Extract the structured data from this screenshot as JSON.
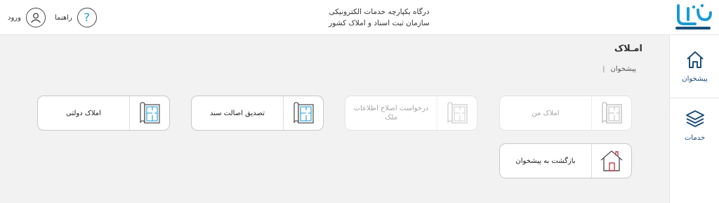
{
  "header": {
    "logo_text": "ثبت من",
    "title_line1": "درگاه یکپارچه خدمات الکترونیکی",
    "title_line2": "سازمان ثبت اسناد و املاک کشور",
    "help_label": "راهنما",
    "login_label": "ورود"
  },
  "sidebar": {
    "items": [
      {
        "label": "پیشخوان",
        "icon": "home-icon",
        "active": true
      },
      {
        "label": "خدمات",
        "icon": "layers-icon",
        "active": false
      }
    ]
  },
  "main": {
    "page_title": "امـلاک",
    "breadcrumb": {
      "current": "پیشخوان",
      "separator": "|"
    },
    "cards": [
      {
        "label": "املاک من",
        "icon": "floorplan-icon",
        "disabled": true
      },
      {
        "label": "درخواست اصلاح اطلاعات ملک",
        "icon": "floorplan-icon",
        "disabled": true
      },
      {
        "label": "تصدیق اصالت سند",
        "icon": "floorplan-icon",
        "disabled": false
      },
      {
        "label": "املاک دولتی",
        "icon": "floorplan-icon",
        "disabled": false
      },
      {
        "label": "بازگشت به پیشخوان",
        "icon": "house-icon",
        "disabled": false
      }
    ]
  },
  "colors": {
    "brand_blue": "#1a9ad6",
    "dark_blue": "#1c4f7a",
    "accent_red": "#c0404a",
    "background": "#f2f2f2"
  }
}
